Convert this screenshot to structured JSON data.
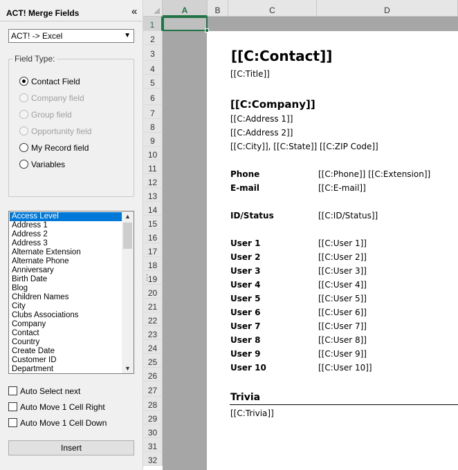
{
  "panel": {
    "title": "ACT! Merge Fields",
    "collapse_icon": "«",
    "mode_select": "ACT! -> Excel",
    "field_type_legend": "Field Type:",
    "field_types": [
      {
        "label": "Contact Field",
        "checked": true,
        "disabled": false
      },
      {
        "label": "Company field",
        "checked": false,
        "disabled": true
      },
      {
        "label": "Group field",
        "checked": false,
        "disabled": true
      },
      {
        "label": "Opportunity field",
        "checked": false,
        "disabled": true
      },
      {
        "label": "My Record field",
        "checked": false,
        "disabled": false
      },
      {
        "label": "Variables",
        "checked": false,
        "disabled": false
      }
    ],
    "fields": [
      "Access Level",
      "Address 1",
      "Address 2",
      "Address 3",
      "Alternate Extension",
      "Alternate Phone",
      "Anniversary",
      "Birth Date",
      "Blog",
      "Children Names",
      "City",
      "Clubs Associations",
      "Company",
      "Contact",
      "Country",
      "Create Date",
      "Customer ID",
      "Department"
    ],
    "selected_field": "Access Level",
    "options": [
      "Auto Select next",
      "Auto Move 1 Cell Right",
      "Auto Move 1 Cell Down"
    ],
    "insert_label": "Insert"
  },
  "sheet": {
    "columns": [
      "A",
      "B",
      "C",
      "D"
    ],
    "active_column": "A",
    "active_row": "1",
    "rows": [
      "1",
      "2",
      "3",
      "4",
      "5",
      "6",
      "7",
      "8",
      "9",
      "10",
      "11",
      "12",
      "13",
      "14",
      "15",
      "16",
      "17",
      "18",
      "19",
      "20",
      "21",
      "22",
      "23",
      "24",
      "25",
      "26",
      "27",
      "28",
      "29",
      "30",
      "31",
      "32"
    ],
    "content": {
      "contact": "[[C:Contact]]",
      "title": "[[C:Title]]",
      "company": "[[C:Company]]",
      "address1": "[[C:Address 1]]",
      "address2": "[[C:Address 2]]",
      "city_line": "[[C:City]], [[C:State]] [[C:ZIP Code]]",
      "phone_label": "Phone",
      "phone_value": "[[C:Phone]] [[C:Extension]]",
      "email_label": "E-mail",
      "email_value": "[[C:E-mail]]",
      "id_label": "ID/Status",
      "id_value": "[[C:ID/Status]]",
      "users": [
        {
          "label": "User 1",
          "value": "[[C:User 1]]"
        },
        {
          "label": "User 2",
          "value": "[[C:User 2]]"
        },
        {
          "label": "User 3",
          "value": "[[C:User 3]]"
        },
        {
          "label": "User 4",
          "value": "[[C:User 4]]"
        },
        {
          "label": "User 5",
          "value": "[[C:User 5]]"
        },
        {
          "label": "User 6",
          "value": "[[C:User 6]]"
        },
        {
          "label": "User 7",
          "value": "[[C:User 7]]"
        },
        {
          "label": "User 8",
          "value": "[[C:User 8]]"
        },
        {
          "label": "User 9",
          "value": "[[C:User 9]]"
        },
        {
          "label": "User 10",
          "value": "[[C:User 10]]"
        }
      ],
      "trivia_heading": "Trivia",
      "trivia_value": "[[C:Trivia]]"
    }
  },
  "colors": {
    "accent_green": "#217346",
    "selection_blue": "#0078d7",
    "gray_area": "#a6a6a6"
  }
}
